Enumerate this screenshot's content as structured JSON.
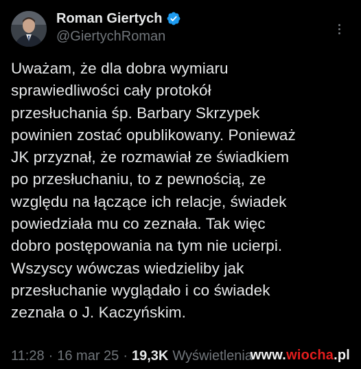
{
  "author": {
    "display_name": "Roman Giertych",
    "handle": "@GiertychRoman",
    "verified": true,
    "avatar_icon": "profile-photo",
    "verified_icon": "verified-badge-icon",
    "more_icon": "more-options-icon"
  },
  "tweet": {
    "text": "Uważam, że dla dobra wymiaru\nsprawiedliwości cały protokół\nprzesłuchania  śp. Barbary Skrzypek\npowinien zostać opublikowany. Ponieważ\nJK przyznał, że rozmawiał ze świadkiem\npo przesłuchaniu,   to z pewnością, ze\nwzględu na łączące ich relacje, świadek\npowiedziała mu co zeznała. Tak więc\ndobro postępowania na tym nie ucierpi.\nWszyscy wówczas wiedzieliby jak\nprzesłuchanie wyglądało i co świadek\nzeznała o J. Kaczyńskim.",
    "time": "11:28",
    "dot": "·",
    "date": "16 mar 25",
    "views_count": "19,3K",
    "views_label": "Wyświetlenia"
  },
  "watermark": {
    "prefix": "www.",
    "accent": "wiocha",
    "suffix": ".pl"
  },
  "colors": {
    "background": "#000000",
    "text": "#e7e9ea",
    "secondary": "#71767b",
    "verified": "#1d9bf0",
    "watermark_accent": "#e21d1d"
  }
}
